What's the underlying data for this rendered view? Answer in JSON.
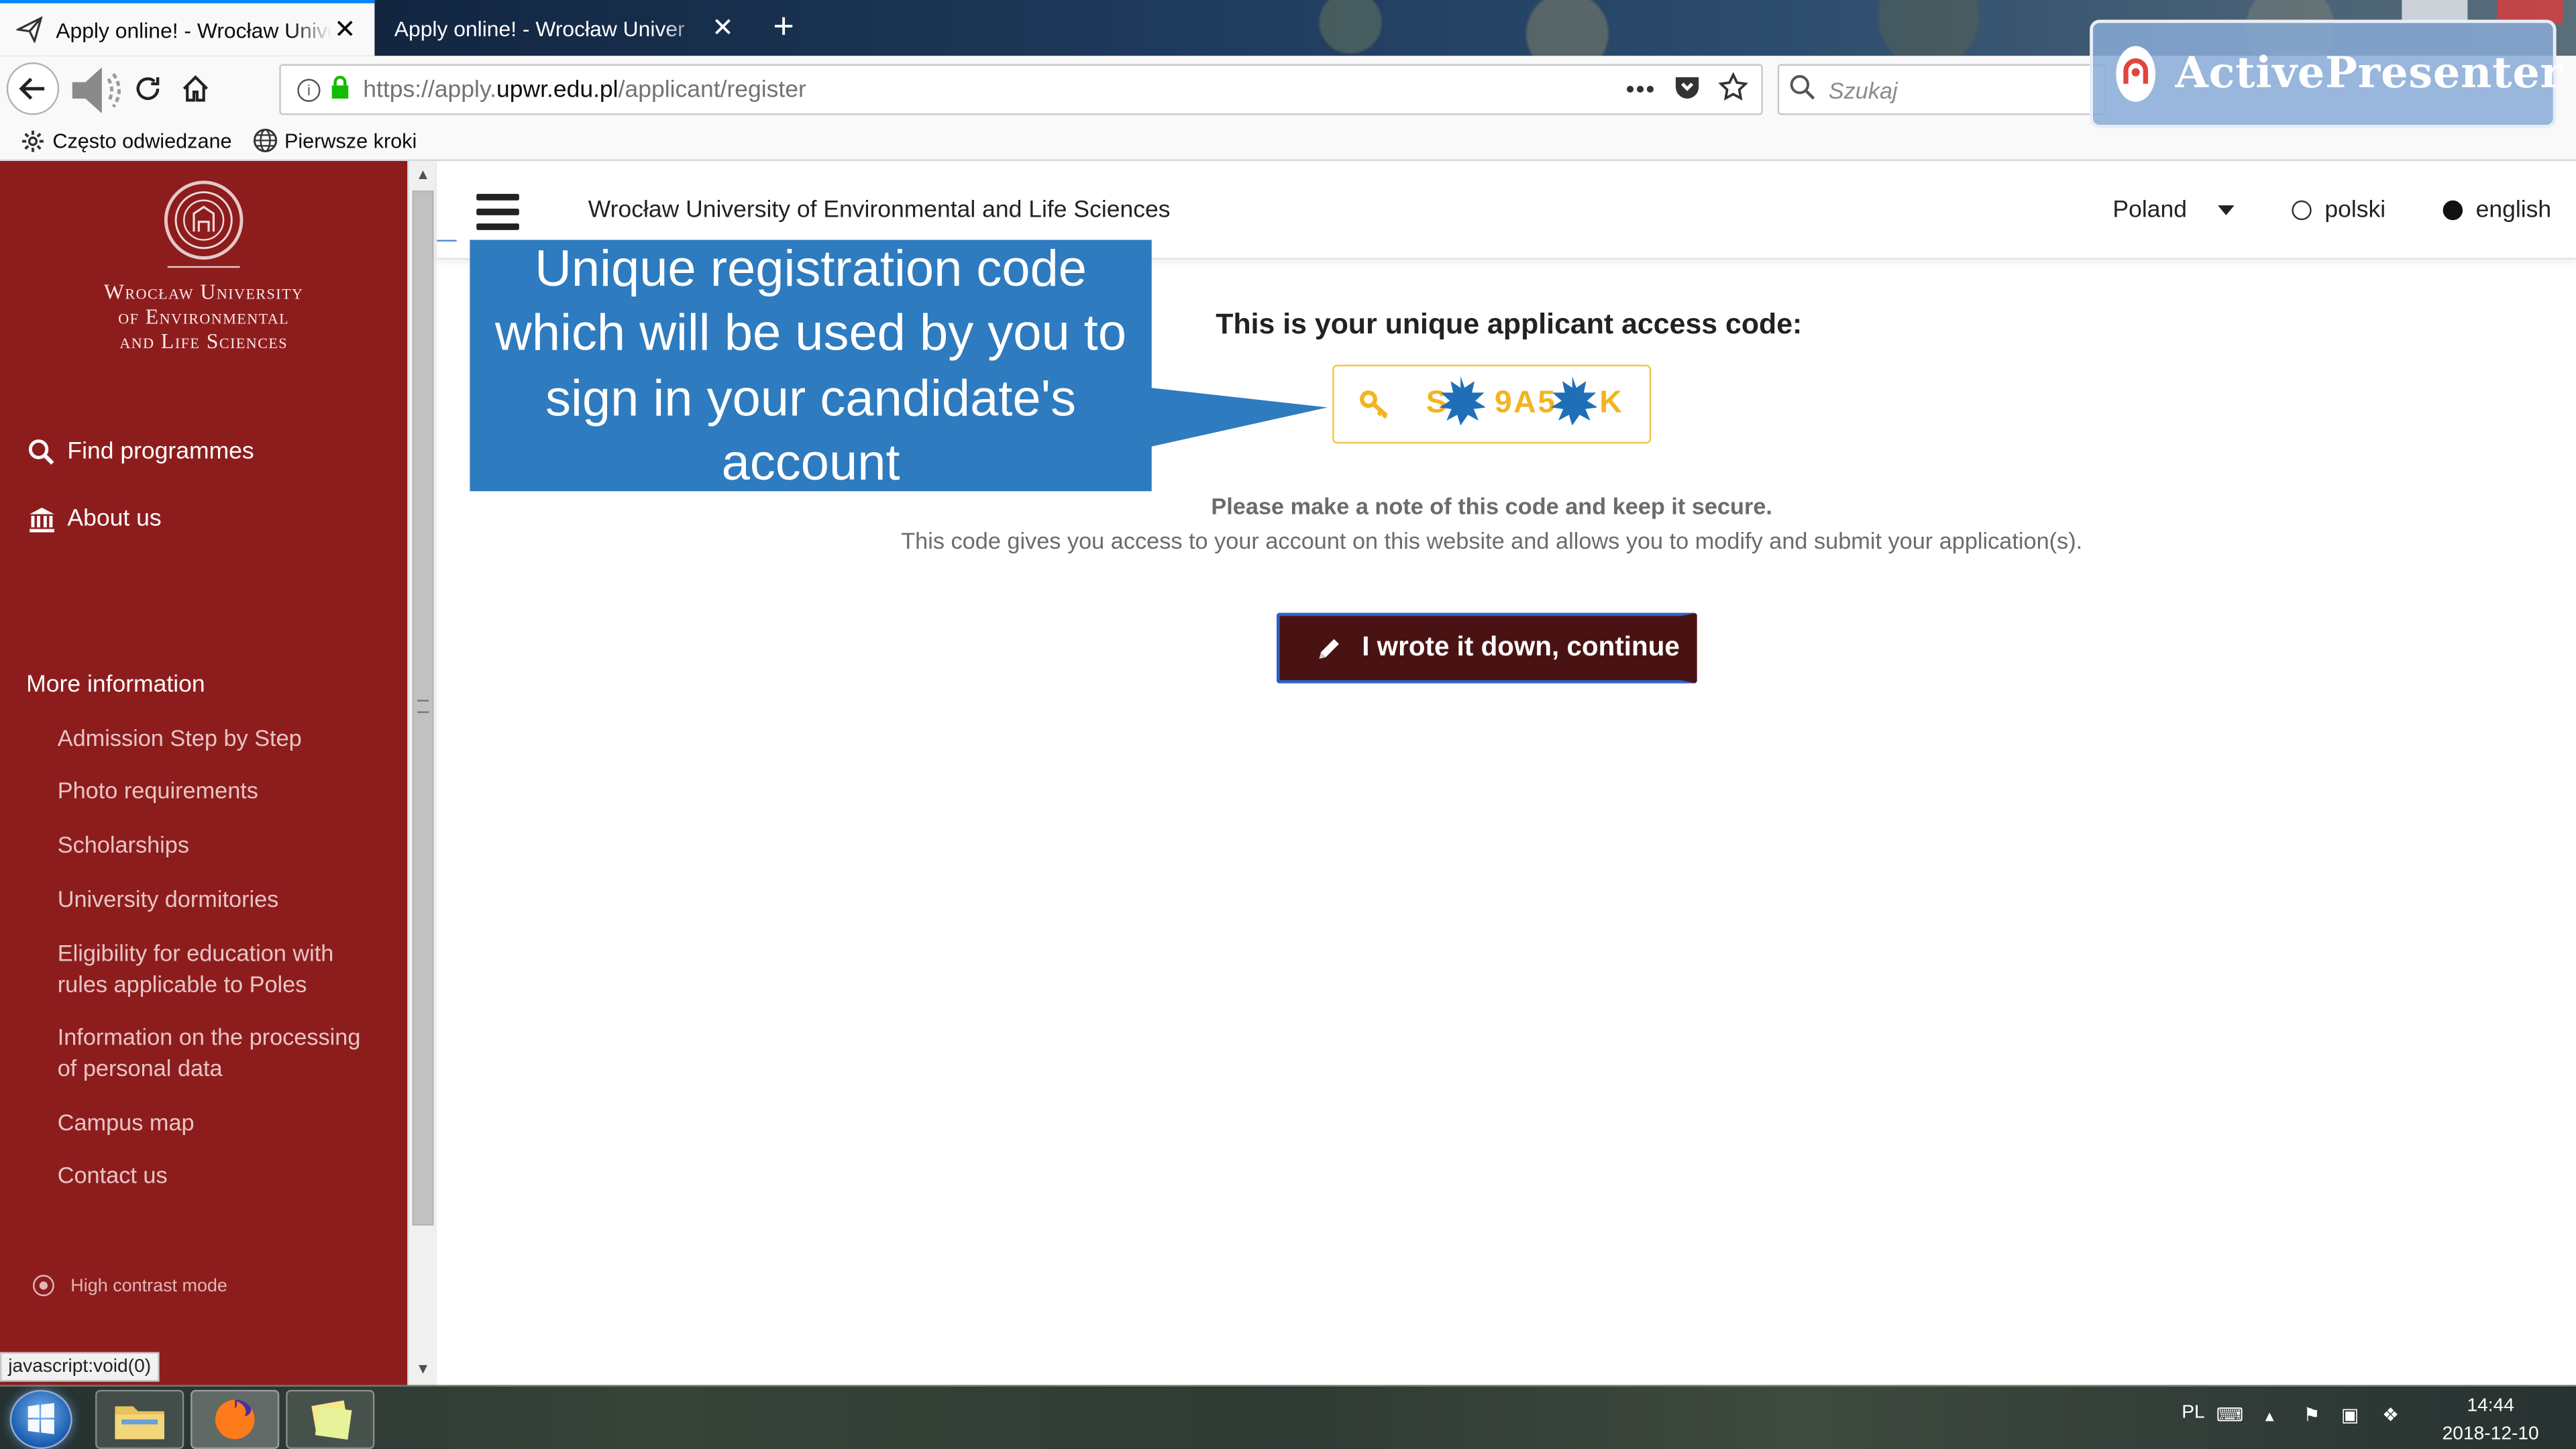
{
  "browser": {
    "tabs": [
      {
        "title": "Apply online! - Wrocław Univer",
        "active": true
      },
      {
        "title": "Apply online! - Wrocław Univer",
        "active": false
      }
    ],
    "url": {
      "scheme": "https://apply.",
      "host": "upwr.edu.pl",
      "path": "/applicant/register"
    },
    "search_placeholder": "Szukaj",
    "bookmarks": [
      "Często odwiedzane",
      "Pierwsze kroki"
    ],
    "status_link": "javascript:void(0)"
  },
  "overlay": {
    "brand": "ActivePresenter",
    "callout": "Unique registration code which will be used by you to sign in your candidate's account"
  },
  "sidebar": {
    "university": [
      "Wrocław University",
      "of Environmental",
      "and Life Sciences"
    ],
    "nav": [
      {
        "label": "Find programmes",
        "icon": "search-icon"
      },
      {
        "label": "About us",
        "icon": "institution-icon"
      }
    ],
    "more_title": "More information",
    "links": [
      "Admission Step by Step",
      "Photo requirements",
      "Scholarships",
      "University dormitories",
      "Eligibility for education with rules applicable to Poles",
      "Information on the processing of personal data",
      "Campus map",
      "Contact us"
    ],
    "high_contrast": "High contrast mode"
  },
  "topbar": {
    "site_name": "Wrocław University of Environmental and Life Sciences",
    "country": "Poland",
    "languages": [
      {
        "label": "polski",
        "selected": false
      },
      {
        "label": "english",
        "selected": true
      }
    ]
  },
  "content": {
    "heading": "This is your unique applicant access code:",
    "code_visible": [
      "S",
      "9A5",
      "K"
    ],
    "note_bold": "Please make a note of this code and keep it secure.",
    "note": "This code gives you access to your account on this website and allows you to modify and submit your application(s).",
    "continue_label": "I wrote it down, continue"
  },
  "taskbar": {
    "lang": "PL",
    "time": "14:44",
    "date": "2018-12-10"
  },
  "colors": {
    "sidebar": "#8d1d1d",
    "code": "#f2b422",
    "button": "#4a1313",
    "callout": "#2e7bbf"
  }
}
